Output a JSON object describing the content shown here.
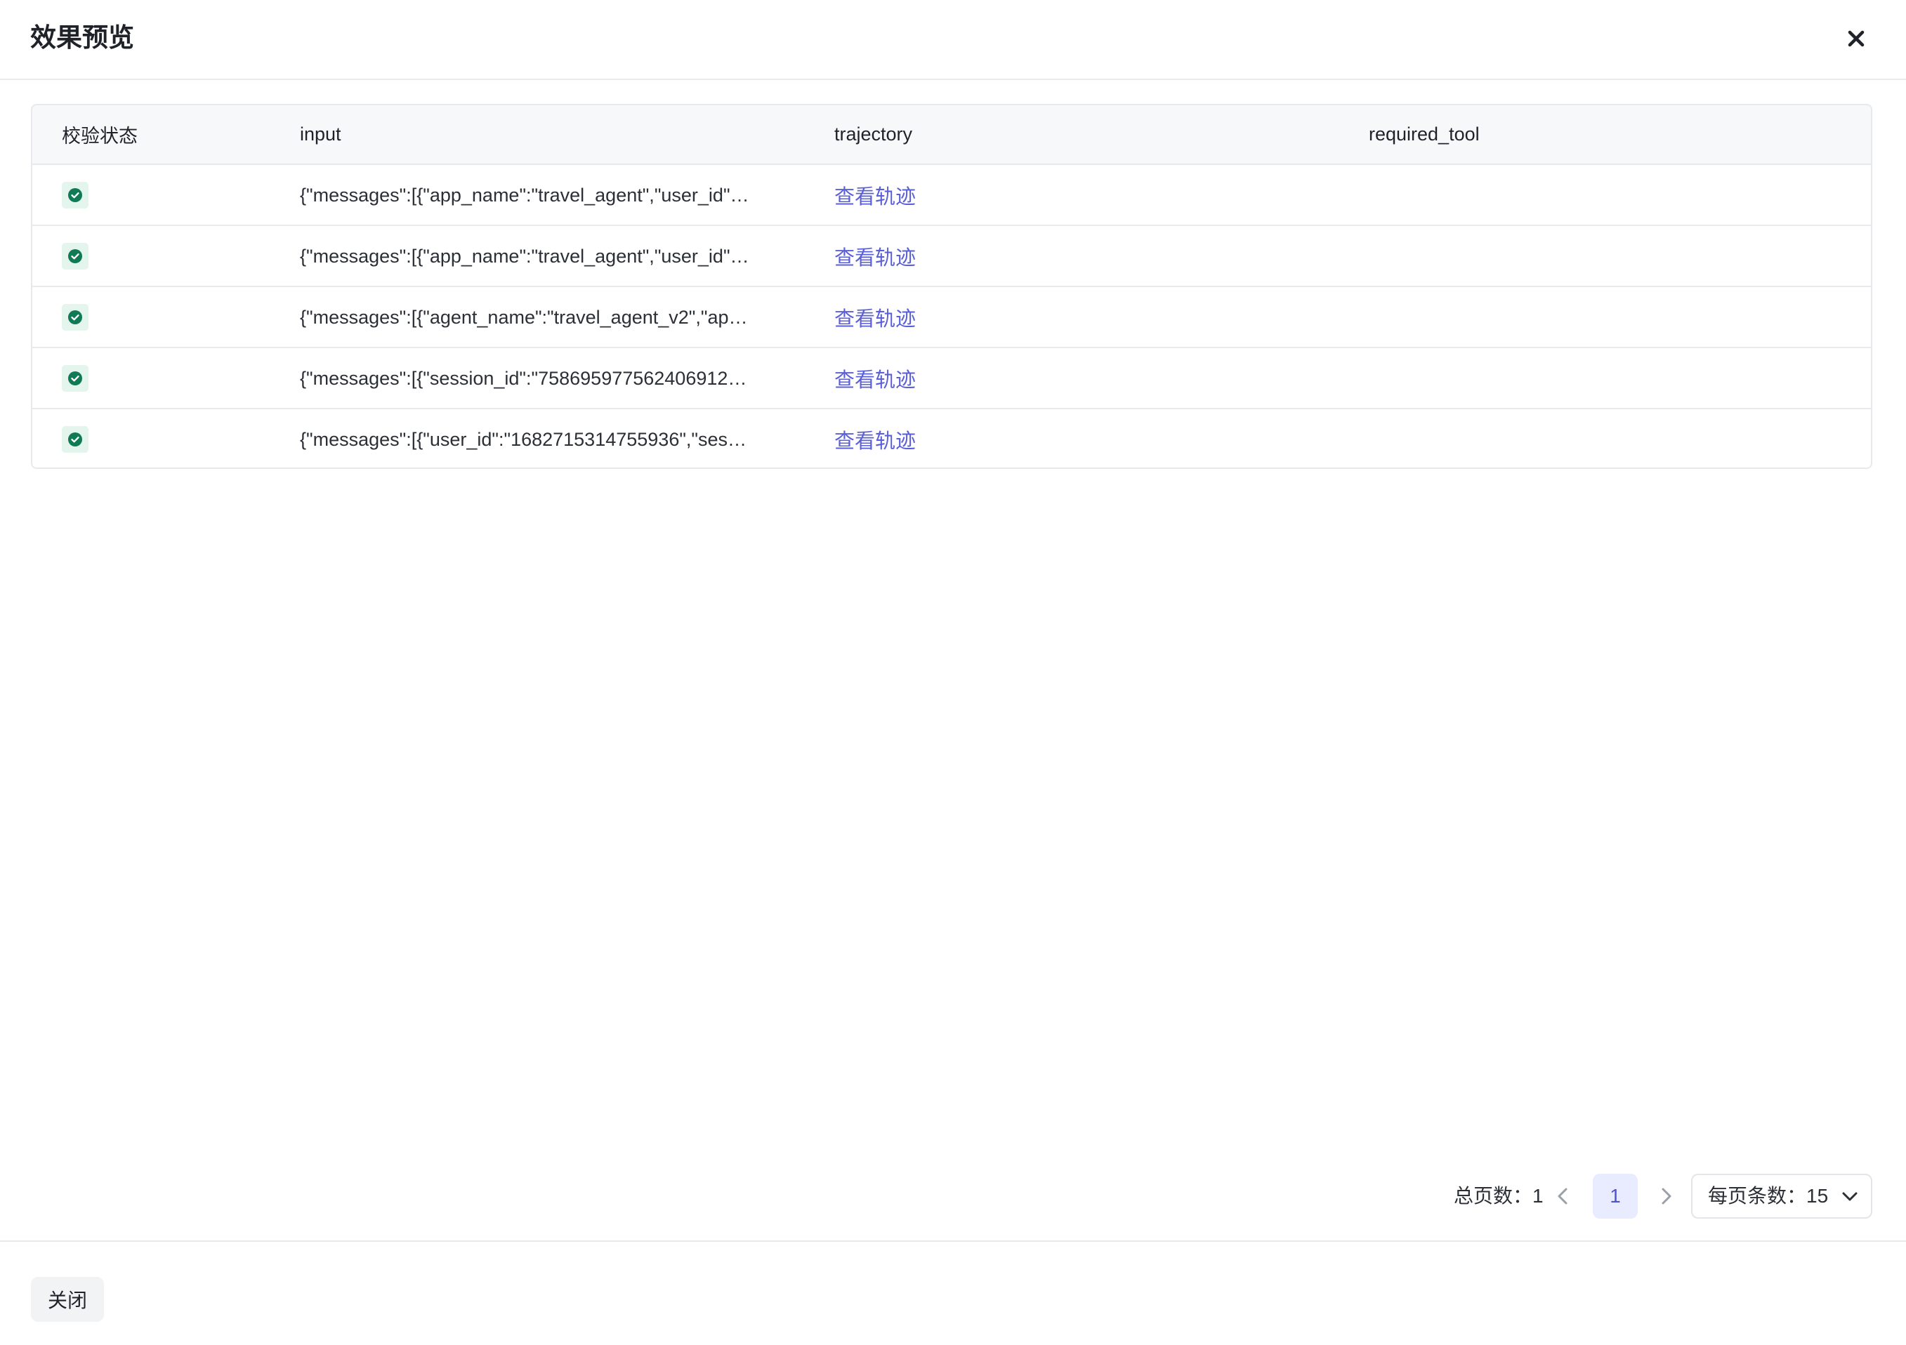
{
  "dialog": {
    "title": "效果预览"
  },
  "table": {
    "columns": [
      "校验状态",
      "input",
      "trajectory",
      "required_tool"
    ],
    "rows": [
      {
        "status": "success",
        "input": "{\"messages\":[{\"app_name\":\"travel_agent\",\"user_id\"…",
        "trajectory_link": "查看轨迹",
        "required_tool": ""
      },
      {
        "status": "success",
        "input": "{\"messages\":[{\"app_name\":\"travel_agent\",\"user_id\"…",
        "trajectory_link": "查看轨迹",
        "required_tool": ""
      },
      {
        "status": "success",
        "input": "{\"messages\":[{\"agent_name\":\"travel_agent_v2\",\"ap…",
        "trajectory_link": "查看轨迹",
        "required_tool": ""
      },
      {
        "status": "success",
        "input": "{\"messages\":[{\"session_id\":\"758695977562406912…",
        "trajectory_link": "查看轨迹",
        "required_tool": ""
      },
      {
        "status": "success",
        "input": "{\"messages\":[{\"user_id\":\"1682715314755936\",\"ses…",
        "trajectory_link": "查看轨迹",
        "required_tool": ""
      }
    ]
  },
  "pagination": {
    "total_pages_label": "总页数：1",
    "current_page": "1",
    "page_size_label": "每页条数：15"
  },
  "footer": {
    "close_label": "关闭"
  },
  "colors": {
    "accent": "#5a5fd6",
    "success": "#0f7a55",
    "success_bg": "#e3f5ec"
  }
}
